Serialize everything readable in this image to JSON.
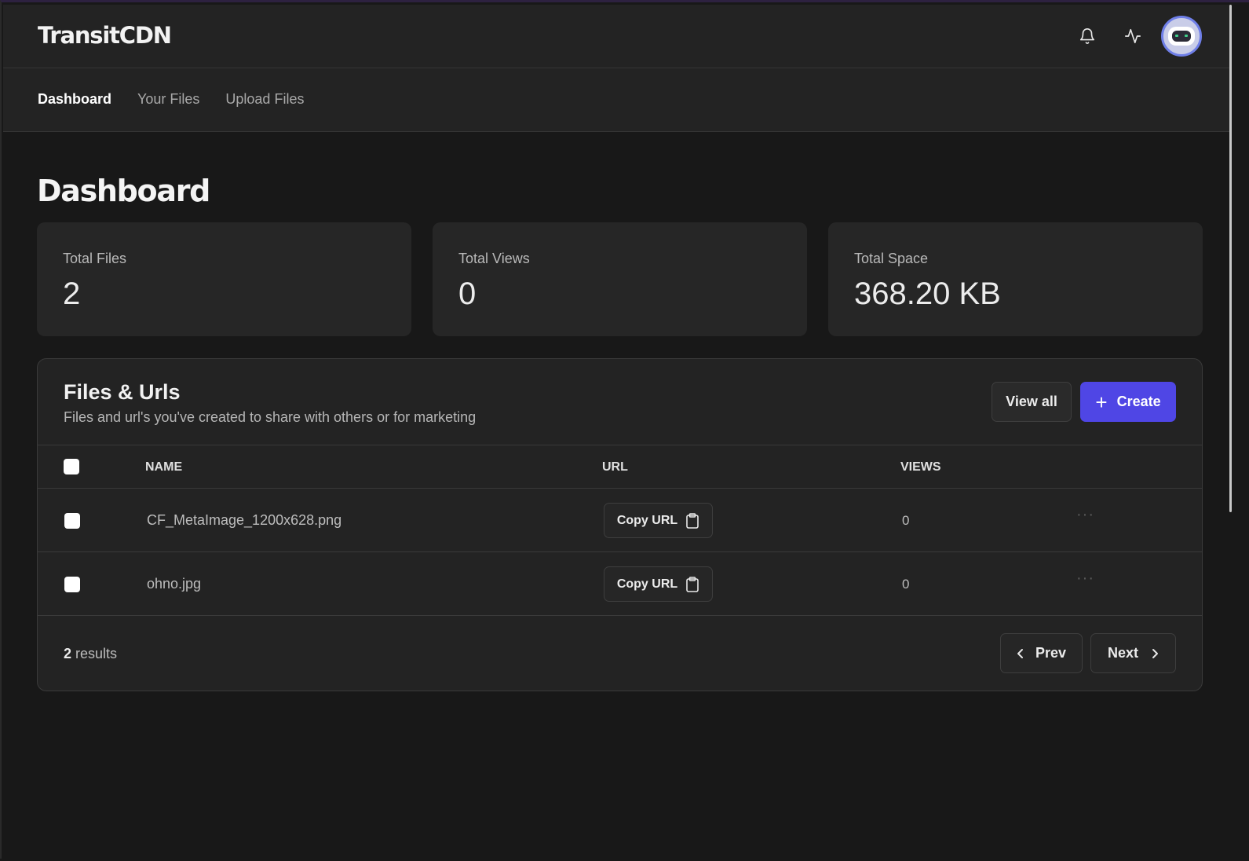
{
  "app": {
    "brand": "TransitCDN"
  },
  "header": {
    "icons": [
      "bell-icon",
      "activity-icon"
    ],
    "avatar": "robot-avatar"
  },
  "nav": {
    "items": [
      {
        "label": "Dashboard",
        "active": true
      },
      {
        "label": "Your Files",
        "active": false
      },
      {
        "label": "Upload Files",
        "active": false
      }
    ]
  },
  "page": {
    "title": "Dashboard"
  },
  "stats": [
    {
      "label": "Total Files",
      "value": "2"
    },
    {
      "label": "Total Views",
      "value": "0"
    },
    {
      "label": "Total Space",
      "value": "368.20 KB"
    }
  ],
  "files_panel": {
    "title": "Files & Urls",
    "subtitle": "Files and url's you've created to share with others or for marketing",
    "view_all_label": "View all",
    "create_label": "Create",
    "columns": [
      "NAME",
      "URL",
      "VIEWS"
    ],
    "rows": [
      {
        "name": "CF_MetaImage_1200x628.png",
        "copy_label": "Copy URL",
        "views": "0"
      },
      {
        "name": "ohno.jpg",
        "copy_label": "Copy URL",
        "views": "0"
      }
    ],
    "footer": {
      "results_count": "2",
      "results_label": "results",
      "prev_label": "Prev",
      "next_label": "Next"
    }
  },
  "colors": {
    "accent": "#4f46e5",
    "background": "#181818",
    "surface": "#232323"
  }
}
